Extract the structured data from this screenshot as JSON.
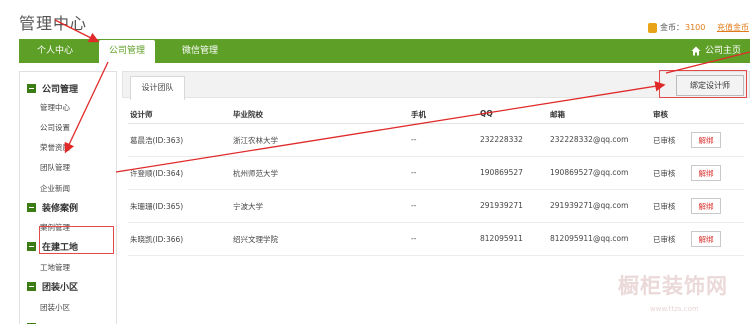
{
  "header": {
    "title": "管理中心",
    "coin_label": "金币：",
    "coin_value": "3100",
    "recharge": "充值金币"
  },
  "nav": {
    "items": [
      {
        "label": "个人中心"
      },
      {
        "label": "公司管理"
      },
      {
        "label": "微信管理"
      }
    ],
    "active_index": 1,
    "home": "公司主页"
  },
  "sidebar": {
    "sections": [
      {
        "title": "公司管理",
        "items": [
          "管理中心",
          "公司设置",
          "荣誉资质",
          "团队管理",
          "企业新闻"
        ]
      },
      {
        "title": "装修案例",
        "items": [
          "案例管理"
        ]
      },
      {
        "title": "在建工地",
        "items": [
          "工地管理"
        ]
      },
      {
        "title": "团装小区",
        "items": [
          "团装小区"
        ]
      }
    ]
  },
  "content": {
    "tab": "设计团队",
    "bind_button": "绑定设计师",
    "columns": [
      "设计师",
      "毕业院校",
      "手机",
      "QQ",
      "邮箱",
      "审核"
    ],
    "rows": [
      {
        "designer": "葛晨浩(ID:363)",
        "school": "浙江农林大学",
        "phone": "--",
        "qq": "232228332",
        "email": "232228332@qq.com",
        "status": "已审核",
        "action": "解绑"
      },
      {
        "designer": "许登顺(ID:364)",
        "school": "杭州师范大学",
        "phone": "--",
        "qq": "190869527",
        "email": "190869527@qq.com",
        "status": "已审核",
        "action": "解绑"
      },
      {
        "designer": "朱珊珊(ID:365)",
        "school": "宁波大学",
        "phone": "--",
        "qq": "291939271",
        "email": "291939271@qq.com",
        "status": "已审核",
        "action": "解绑"
      },
      {
        "designer": "朱晓凯(ID:366)",
        "school": "绍兴文理学院",
        "phone": "--",
        "qq": "812095911",
        "email": "812095911@qq.com",
        "status": "已审核",
        "action": "解绑"
      }
    ]
  },
  "watermark": {
    "text": "橱柜装饰网",
    "sub": "www.ttzs.com"
  },
  "colors": {
    "nav_green": "#5e9f27",
    "annotation_red": "#e02a2a",
    "link_orange": "#e07b1a"
  }
}
